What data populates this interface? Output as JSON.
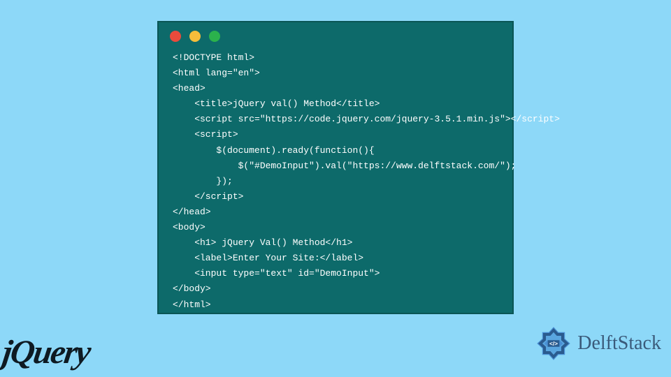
{
  "code": {
    "line1": "<!DOCTYPE html>",
    "line2": "<html lang=\"en\">",
    "line3": "<head>",
    "line4": "    <title>jQuery val() Method</title>",
    "line5": "    <script src=\"https://code.jquery.com/jquery-3.5.1.min.js\"></script>",
    "line6": "    <script>",
    "line7": "        $(document).ready(function(){",
    "line8": "            $(\"#DemoInput\").val(\"https://www.delftstack.com/\");",
    "line9": "        });",
    "line10": "    </script>",
    "line11": "</head>",
    "line12": "<body>",
    "line13": "    <h1> jQuery Val() Method</h1>",
    "line14": "    <label>Enter Your Site:</label>",
    "line15": "    <input type=\"text\" id=\"DemoInput\">",
    "line16": "</body>",
    "line17": "</html>"
  },
  "logos": {
    "jquery": "jQuery",
    "delft": "DelftStack"
  }
}
